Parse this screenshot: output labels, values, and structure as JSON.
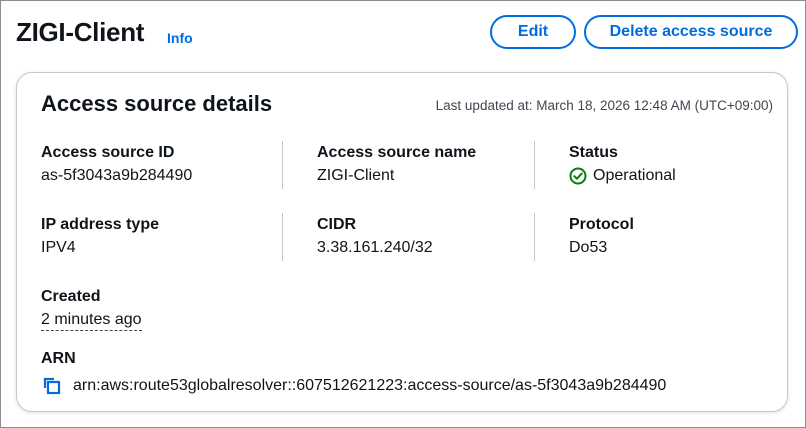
{
  "header": {
    "title": "ZIGI-Client",
    "info_label": "Info",
    "edit_label": "Edit",
    "delete_label": "Delete access source"
  },
  "card": {
    "title": "Access source details",
    "last_updated": "Last updated at: March 18, 2026 12:48 AM (UTC+09:00)",
    "fields": {
      "access_source_id": {
        "label": "Access source ID",
        "value": "as-5f3043a9b284490"
      },
      "access_source_name": {
        "label": "Access source name",
        "value": "ZIGI-Client"
      },
      "status": {
        "label": "Status",
        "value": "Operational",
        "icon": "check-circle-icon",
        "color": "#037f0c"
      },
      "ip_address_type": {
        "label": "IP address type",
        "value": "IPV4"
      },
      "cidr": {
        "label": "CIDR",
        "value": "3.38.161.240/32"
      },
      "protocol": {
        "label": "Protocol",
        "value": "Do53"
      },
      "created": {
        "label": "Created",
        "value": "2 minutes ago"
      },
      "arn": {
        "label": "ARN",
        "value": "arn:aws:route53globalresolver::607512621223:access-source/as-5f3043a9b284490",
        "icon": "copy-icon"
      }
    }
  },
  "colors": {
    "accent": "#006ce0",
    "success": "#037f0c",
    "text": "#0f141a",
    "muted": "#424650"
  }
}
